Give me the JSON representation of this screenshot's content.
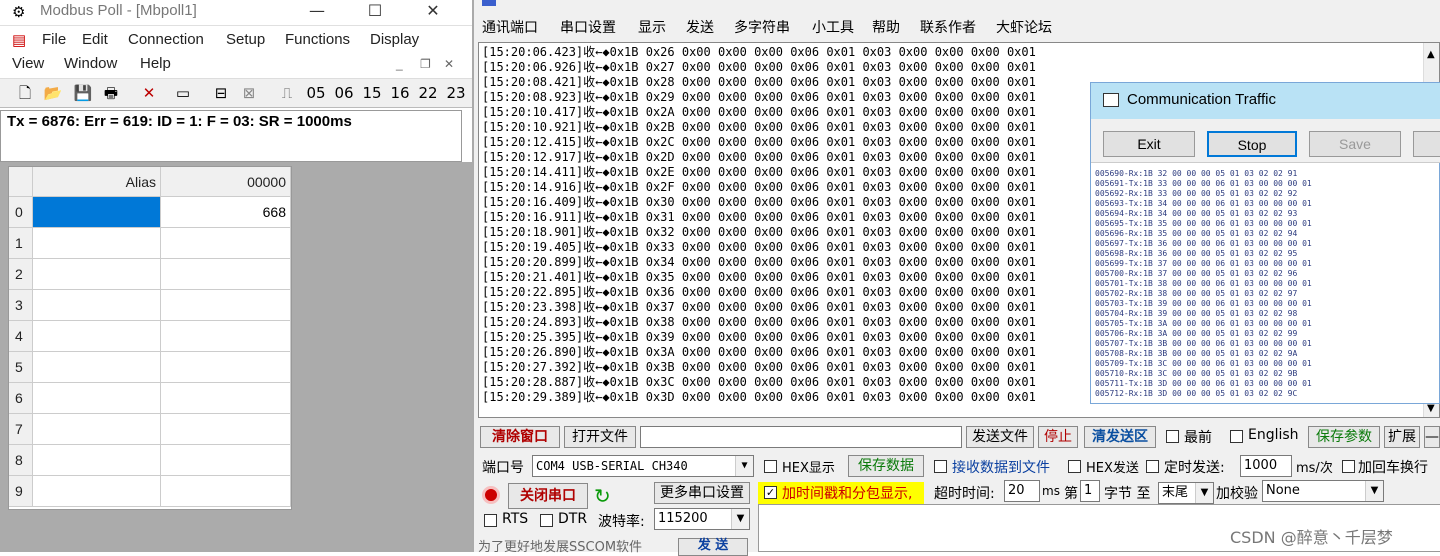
{
  "modbus": {
    "title": "Modbus Poll - [Mbpoll1]",
    "menu": [
      "File",
      "Edit",
      "Connection",
      "Setup",
      "Functions",
      "Display",
      "View",
      "Window",
      "Help"
    ],
    "toolbar_nums": [
      "05",
      "06",
      "15",
      "16",
      "22",
      "23"
    ],
    "status": "Tx = 6876: Err = 619: ID = 1: F = 03: SR = 1000ms",
    "grid": {
      "col_alias": "Alias",
      "col_value": "00000",
      "rows": [
        "0",
        "1",
        "2",
        "3",
        "4",
        "5",
        "6",
        "7",
        "8",
        "9"
      ],
      "value0": "668"
    }
  },
  "sscom": {
    "menu": [
      "通讯端口",
      "串口设置",
      "显示",
      "发送",
      "多字符串",
      "小工具",
      "帮助",
      "联系作者",
      "大虾论坛"
    ],
    "log": [
      "[15:20:06.423]收←◆0x1B 0x26 0x00 0x00 0x00 0x06 0x01 0x03 0x00 0x00 0x00 0x01",
      "[15:20:06.926]收←◆0x1B 0x27 0x00 0x00 0x00 0x06 0x01 0x03 0x00 0x00 0x00 0x01",
      "[15:20:08.421]收←◆0x1B 0x28 0x00 0x00 0x00 0x06 0x01 0x03 0x00 0x00 0x00 0x01",
      "[15:20:08.923]收←◆0x1B 0x29 0x00 0x00 0x00 0x06 0x01 0x03 0x00 0x00 0x00 0x01",
      "[15:20:10.417]收←◆0x1B 0x2A 0x00 0x00 0x00 0x06 0x01 0x03 0x00 0x00 0x00 0x01",
      "[15:20:10.921]收←◆0x1B 0x2B 0x00 0x00 0x00 0x06 0x01 0x03 0x00 0x00 0x00 0x01",
      "[15:20:12.415]收←◆0x1B 0x2C 0x00 0x00 0x00 0x06 0x01 0x03 0x00 0x00 0x00 0x01",
      "[15:20:12.917]收←◆0x1B 0x2D 0x00 0x00 0x00 0x06 0x01 0x03 0x00 0x00 0x00 0x01",
      "[15:20:14.411]收←◆0x1B 0x2E 0x00 0x00 0x00 0x06 0x01 0x03 0x00 0x00 0x00 0x01",
      "[15:20:14.916]收←◆0x1B 0x2F 0x00 0x00 0x00 0x06 0x01 0x03 0x00 0x00 0x00 0x01",
      "[15:20:16.409]收←◆0x1B 0x30 0x00 0x00 0x00 0x06 0x01 0x03 0x00 0x00 0x00 0x01",
      "[15:20:16.911]收←◆0x1B 0x31 0x00 0x00 0x00 0x06 0x01 0x03 0x00 0x00 0x00 0x01",
      "[15:20:18.901]收←◆0x1B 0x32 0x00 0x00 0x00 0x06 0x01 0x03 0x00 0x00 0x00 0x01",
      "[15:20:19.405]收←◆0x1B 0x33 0x00 0x00 0x00 0x06 0x01 0x03 0x00 0x00 0x00 0x01",
      "[15:20:20.899]收←◆0x1B 0x34 0x00 0x00 0x00 0x06 0x01 0x03 0x00 0x00 0x00 0x01",
      "[15:20:21.401]收←◆0x1B 0x35 0x00 0x00 0x00 0x06 0x01 0x03 0x00 0x00 0x00 0x01",
      "[15:20:22.895]收←◆0x1B 0x36 0x00 0x00 0x00 0x06 0x01 0x03 0x00 0x00 0x00 0x01",
      "[15:20:23.398]收←◆0x1B 0x37 0x00 0x00 0x00 0x06 0x01 0x03 0x00 0x00 0x00 0x01",
      "[15:20:24.893]收←◆0x1B 0x38 0x00 0x00 0x00 0x06 0x01 0x03 0x00 0x00 0x00 0x01",
      "[15:20:25.395]收←◆0x1B 0x39 0x00 0x00 0x00 0x06 0x01 0x03 0x00 0x00 0x00 0x01",
      "[15:20:26.890]收←◆0x1B 0x3A 0x00 0x00 0x00 0x06 0x01 0x03 0x00 0x00 0x00 0x01",
      "[15:20:27.392]收←◆0x1B 0x3B 0x00 0x00 0x00 0x06 0x01 0x03 0x00 0x00 0x00 0x01",
      "[15:20:28.887]收←◆0x1B 0x3C 0x00 0x00 0x00 0x06 0x01 0x03 0x00 0x00 0x00 0x01",
      "[15:20:29.389]收←◆0x1B 0x3D 0x00 0x00 0x00 0x06 0x01 0x03 0x00 0x00 0x00 0x01"
    ],
    "buttons": {
      "clear": "清除窗口",
      "open_file": "打开文件",
      "send_file": "发送文件",
      "stop": "停止",
      "clear_send": "清发送区",
      "topmost": "最前",
      "english": "English",
      "save_params": "保存参数",
      "expand": "扩展",
      "dash": "—"
    },
    "row2": {
      "port_label": "端口号",
      "port_value": "COM4 USB-SERIAL CH340",
      "hex_show": "HEX显示",
      "save_data": "保存数据",
      "recv_to_file": "接收数据到文件",
      "hex_send": "HEX发送",
      "timed_send": "定时发送:",
      "interval": "1000",
      "interval_unit": "ms/次",
      "add_crlf": "加回车换行"
    },
    "row3": {
      "close_port": "关闭串口",
      "more_settings": "更多串口设置",
      "timestamp": "加时间戳和分包显示,",
      "timeout_label": "超时时间:",
      "timeout": "20",
      "ms": "ms",
      "frame_label": "第",
      "frame": "1",
      "byte_label": "字节 至",
      "end": "末尾",
      "checksum_label": "加校验",
      "checksum": "None"
    },
    "row4": {
      "rts": "RTS",
      "dtr": "DTR",
      "baud_label": "波特率:",
      "baud": "115200"
    },
    "footer": "为了更好地发展SSCOM软件",
    "send": "发 送",
    "watermark": "CSDN @醉意丶千层梦"
  },
  "traffic": {
    "title": "Communication Traffic",
    "buttons": [
      "Exit",
      "Stop",
      "Save"
    ],
    "lines": [
      "005690-Rx:1B 32 00 00 00 05 01 03 02 02 91",
      "005691-Tx:1B 33 00 00 00 06 01 03 00 00 00 01",
      "005692-Rx:1B 33 00 00 00 05 01 03 02 02 92",
      "005693-Tx:1B 34 00 00 00 06 01 03 00 00 00 01",
      "005694-Rx:1B 34 00 00 00 05 01 03 02 02 93",
      "005695-Tx:1B 35 00 00 00 06 01 03 00 00 00 01",
      "005696-Rx:1B 35 00 00 00 05 01 03 02 02 94",
      "005697-Tx:1B 36 00 00 00 06 01 03 00 00 00 01",
      "005698-Rx:1B 36 00 00 00 05 01 03 02 02 95",
      "005699-Tx:1B 37 00 00 00 06 01 03 00 00 00 01",
      "005700-Rx:1B 37 00 00 00 05 01 03 02 02 96",
      "005701-Tx:1B 38 00 00 00 06 01 03 00 00 00 01",
      "005702-Rx:1B 38 00 00 00 05 01 03 02 02 97",
      "005703-Tx:1B 39 00 00 00 06 01 03 00 00 00 01",
      "005704-Rx:1B 39 00 00 00 05 01 03 02 02 98",
      "005705-Tx:1B 3A 00 00 00 06 01 03 00 00 00 01",
      "005706-Rx:1B 3A 00 00 00 05 01 03 02 02 99",
      "005707-Tx:1B 3B 00 00 00 06 01 03 00 00 00 01",
      "005708-Rx:1B 3B 00 00 00 05 01 03 02 02 9A",
      "005709-Tx:1B 3C 00 00 00 06 01 03 00 00 00 01",
      "005710-Rx:1B 3C 00 00 00 05 01 03 02 02 9B",
      "005711-Tx:1B 3D 00 00 00 06 01 03 00 00 00 01",
      "005712-Rx:1B 3D 00 00 00 05 01 03 02 02 9C"
    ]
  },
  "colors": {
    "selection": "#0078d7",
    "traffic_title": "#b9e2f5",
    "green_text": "#0a7a0a",
    "red_text": "#b00000"
  }
}
